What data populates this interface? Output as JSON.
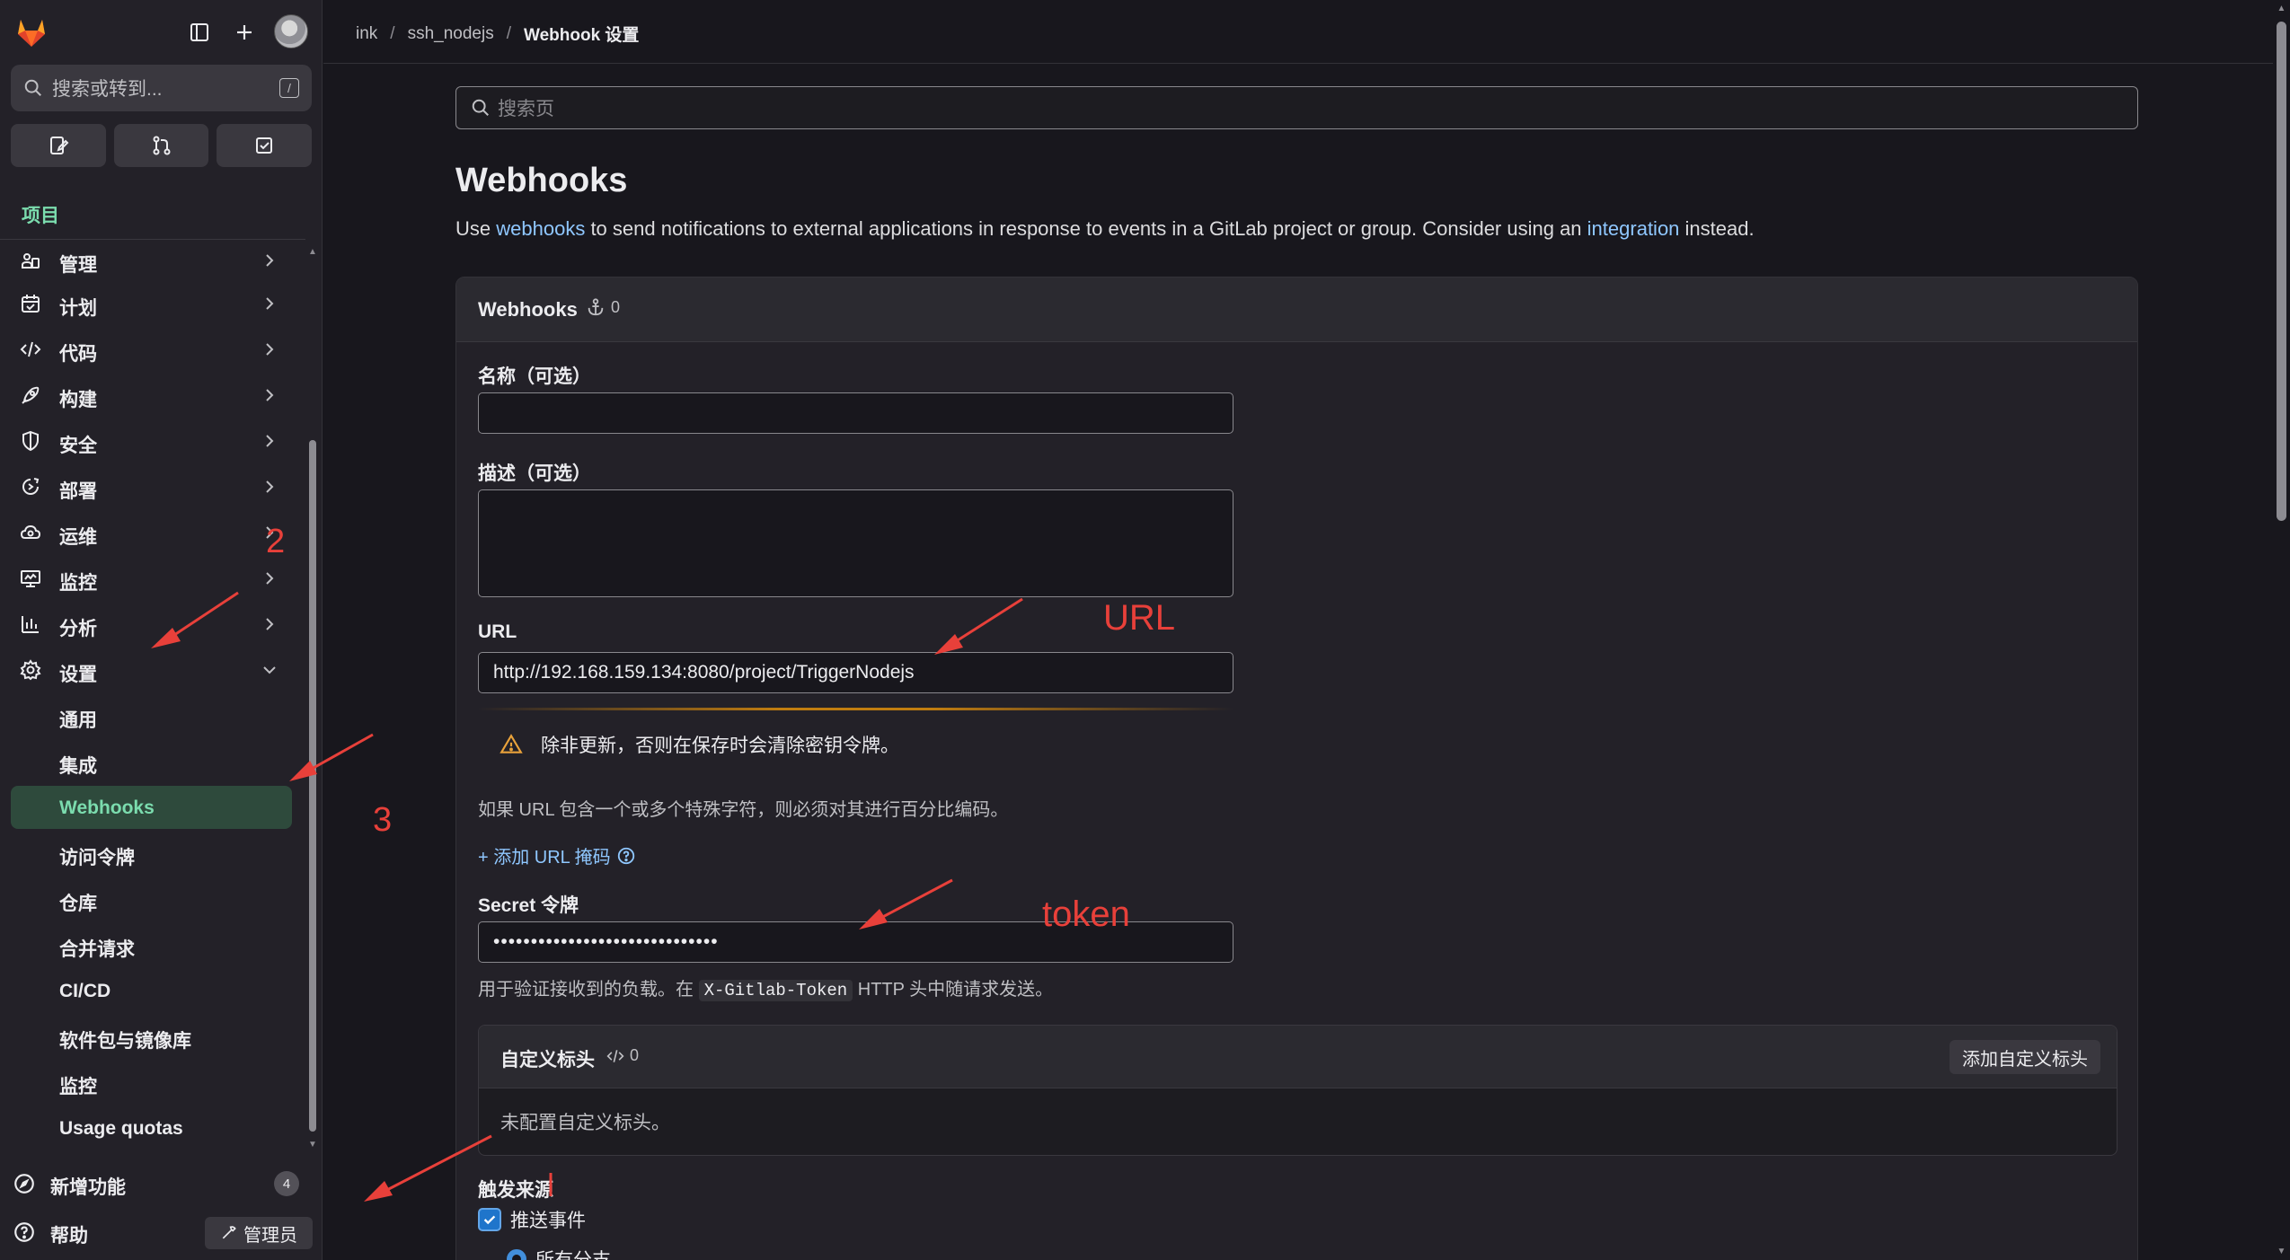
{
  "sidebar": {
    "search_placeholder": "搜索或转到...",
    "search_shortcut": "/",
    "section_title": "项目",
    "nav_items": [
      {
        "label": "管理",
        "icon": "users-icon"
      },
      {
        "label": "计划",
        "icon": "calendar-icon"
      },
      {
        "label": "代码",
        "icon": "code-icon"
      },
      {
        "label": "构建",
        "icon": "rocket-icon"
      },
      {
        "label": "安全",
        "icon": "shield-icon"
      },
      {
        "label": "部署",
        "icon": "deploy-icon"
      },
      {
        "label": "运维",
        "icon": "cloud-gear-icon"
      },
      {
        "label": "监控",
        "icon": "monitor-icon"
      },
      {
        "label": "分析",
        "icon": "chart-icon"
      },
      {
        "label": "设置",
        "icon": "settings-icon"
      }
    ],
    "settings_sub_items": [
      {
        "label": "通用"
      },
      {
        "label": "集成"
      },
      {
        "label": "Webhooks",
        "active": true
      },
      {
        "label": "访问令牌"
      },
      {
        "label": "仓库"
      },
      {
        "label": "合并请求"
      },
      {
        "label": "CI/CD"
      },
      {
        "label": "软件包与镜像库"
      },
      {
        "label": "监控"
      },
      {
        "label": "Usage quotas"
      }
    ],
    "whats_new_label": "新增功能",
    "whats_new_count": "4",
    "help_label": "帮助",
    "admin_label": "管理员"
  },
  "breadcrumb": {
    "items": [
      "ink",
      "ssh_nodejs",
      "Webhook 设置"
    ]
  },
  "main": {
    "search_placeholder": "搜索页",
    "title": "Webhooks",
    "desc_before": "Use ",
    "desc_link1": "webhooks",
    "desc_mid": " to send notifications to external applications in response to events in a GitLab project or group. Consider using an ",
    "desc_link2": "integration",
    "desc_after": " instead."
  },
  "card": {
    "title": "Webhooks",
    "count": "0",
    "name_label": "名称（可选）",
    "name_value": "",
    "desc_label": "描述（可选）",
    "desc_value": "",
    "url_label": "URL",
    "url_value": "http://192.168.159.134:8080/project/TriggerNodejs",
    "warning_text": "除非更新，否则在保存时会清除密钥令牌。",
    "url_help": "如果 URL 包含一个或多个特殊字符，则必须对其进行百分比编码。",
    "add_mask_link": "+ 添加 URL 掩码",
    "secret_label": "Secret 令牌",
    "secret_value": "••••••••••••••••••••••••••••••",
    "secret_help_before": "用于验证接收到的负载。在 ",
    "secret_help_code": "X-Gitlab-Token",
    "secret_help_after": " HTTP 头中随请求发送。",
    "custom_headers_title": "自定义标头",
    "custom_headers_count": "0",
    "add_header_button": "添加自定义标头",
    "no_headers_text": "未配置自定义标头。",
    "trigger_title": "触发来源",
    "push_events_label": "推送事件",
    "all_branches_label": "所有分支"
  },
  "annotations": {
    "step2": "2",
    "step3": "3",
    "url_note": "URL",
    "token_note": "token",
    "color": "#e8403a"
  },
  "colors": {
    "accent_green": "#7bdcae",
    "link_blue": "#8fc7ff",
    "warning_orange": "#e9a23b"
  }
}
